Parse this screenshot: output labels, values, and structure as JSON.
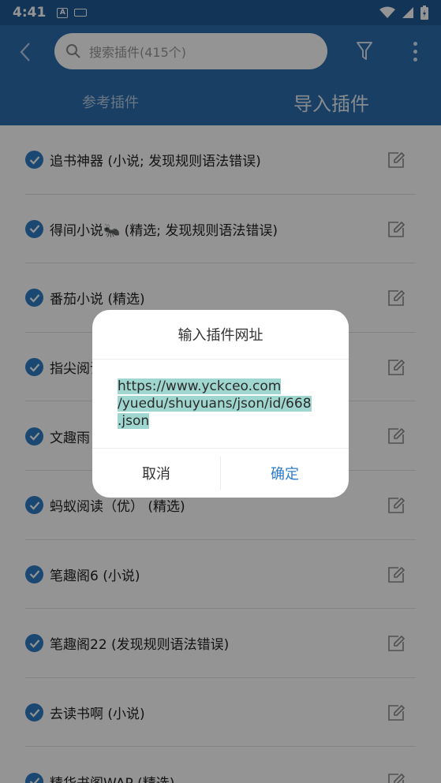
{
  "status_bar": {
    "time": "4:41",
    "notification_icon_letter": "A"
  },
  "toolbar": {
    "search_placeholder": "搜索插件(415个)"
  },
  "tabs": [
    {
      "label": "参考插件"
    },
    {
      "label": "导入插件"
    }
  ],
  "plugins": [
    {
      "label": "追书神器 (小说; 发现规则语法错误)"
    },
    {
      "label": "得间小说🐜 (精选; 发现规则语法错误)"
    },
    {
      "label": "番茄小说 (精选)"
    },
    {
      "label": "指尖阅读"
    },
    {
      "label": "文趣雨"
    },
    {
      "label": "蚂蚁阅读（优） (精选)"
    },
    {
      "label": "笔趣阁6 (小说)"
    },
    {
      "label": "笔趣阁22 (发现规则语法错误)"
    },
    {
      "label": "去读书啊 (小说)"
    },
    {
      "label": "精华书阁WAP (精选)"
    }
  ],
  "dialog": {
    "title": "输入插件网址",
    "url_lines": [
      "https://www.yckceo.com",
      "/yuedu/shuyuans/json/id/668",
      ".json"
    ],
    "cancel_label": "取消",
    "ok_label": "确定"
  },
  "colors": {
    "app_bar": "#2b6dad",
    "status_bar": "#1f5a96",
    "accent": "#2d7cc4",
    "selection": "#9fd6cf"
  }
}
